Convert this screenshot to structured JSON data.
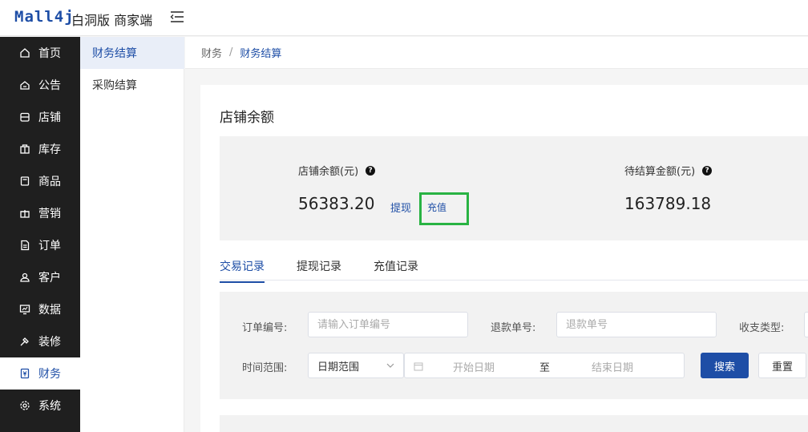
{
  "header": {
    "logo": "Mall4j",
    "title": "白洞版 商家端",
    "menu_toggle_icon": "menu-fold-icon"
  },
  "sidebar": {
    "items": [
      {
        "label": "首页",
        "icon": "home-icon"
      },
      {
        "label": "公告",
        "icon": "announcement-icon"
      },
      {
        "label": "店铺",
        "icon": "shop-icon"
      },
      {
        "label": "库存",
        "icon": "inventory-icon"
      },
      {
        "label": "商品",
        "icon": "product-icon"
      },
      {
        "label": "营销",
        "icon": "gift-icon"
      },
      {
        "label": "订单",
        "icon": "order-icon"
      },
      {
        "label": "客户",
        "icon": "customer-icon"
      },
      {
        "label": "数据",
        "icon": "data-icon"
      },
      {
        "label": "装修",
        "icon": "decorate-icon"
      },
      {
        "label": "财务",
        "icon": "finance-icon",
        "active": true
      },
      {
        "label": "系统",
        "icon": "settings-icon"
      }
    ]
  },
  "subnav": {
    "items": [
      {
        "label": "财务结算",
        "active": true
      },
      {
        "label": "采购结算"
      }
    ]
  },
  "breadcrumb": {
    "root": "财务",
    "separator": "/",
    "current": "财务结算"
  },
  "card": {
    "title": "店铺余额"
  },
  "balance": {
    "shop_balance_label": "店铺余额(元)",
    "shop_balance_value": "56383.20",
    "withdraw_link": "提现",
    "recharge_link": "充值",
    "pending_label": "待结算金额(元)",
    "pending_value": "163789.18",
    "help_glyph": "?"
  },
  "tabs": [
    {
      "label": "交易记录",
      "active": true
    },
    {
      "label": "提现记录"
    },
    {
      "label": "充值记录"
    }
  ],
  "filters": {
    "order_no_label": "订单编号:",
    "order_no_placeholder": "请输入订单编号",
    "refund_no_label": "退款单号:",
    "refund_no_placeholder": "退款单号",
    "type_label": "收支类型:",
    "time_label": "时间范围:",
    "time_select": "日期范围",
    "start_date_placeholder": "开始日期",
    "range_separator": "至",
    "end_date_placeholder": "结束日期",
    "search_button": "搜索",
    "reset_button": "重置"
  },
  "colors": {
    "brand": "#1e4ea6",
    "sidebar_bg": "#1f1f1f",
    "highlight": "#29b343"
  }
}
